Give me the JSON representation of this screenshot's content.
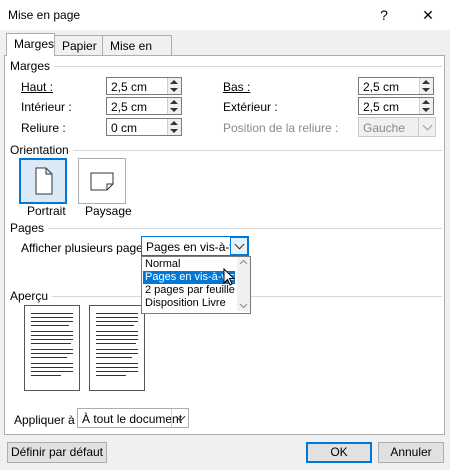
{
  "window": {
    "title": "Mise en page",
    "help": "?",
    "close": "✕"
  },
  "tabs": [
    "Marges",
    "Papier",
    "Mise en page"
  ],
  "marges": {
    "title": "Marges",
    "haut": {
      "label": "Haut :",
      "value": "2,5 cm"
    },
    "bas": {
      "label": "Bas :",
      "value": "2,5 cm"
    },
    "interieur": {
      "label": "Intérieur :",
      "value": "2,5 cm"
    },
    "exterieur": {
      "label": "Extérieur :",
      "value": "2,5 cm"
    },
    "reliure": {
      "label": "Reliure :",
      "value": "0 cm"
    },
    "position_reliure": {
      "label": "Position de la reliure :",
      "value": "Gauche"
    }
  },
  "orientation": {
    "title": "Orientation",
    "portrait": "Portrait",
    "paysage": "Paysage"
  },
  "pages": {
    "title": "Pages",
    "label": "Afficher plusieurs pages :",
    "value": "Pages en vis-à-vis",
    "options": [
      "Normal",
      "Pages en vis-à-vis",
      "2 pages par feuille",
      "Disposition Livre"
    ],
    "selected_index": 1
  },
  "apercu": {
    "title": "Aperçu"
  },
  "appliquer": {
    "label": "Appliquer à :",
    "value": "À tout le document"
  },
  "buttons": {
    "default": "Définir par défaut",
    "ok": "OK",
    "cancel": "Annuler"
  }
}
